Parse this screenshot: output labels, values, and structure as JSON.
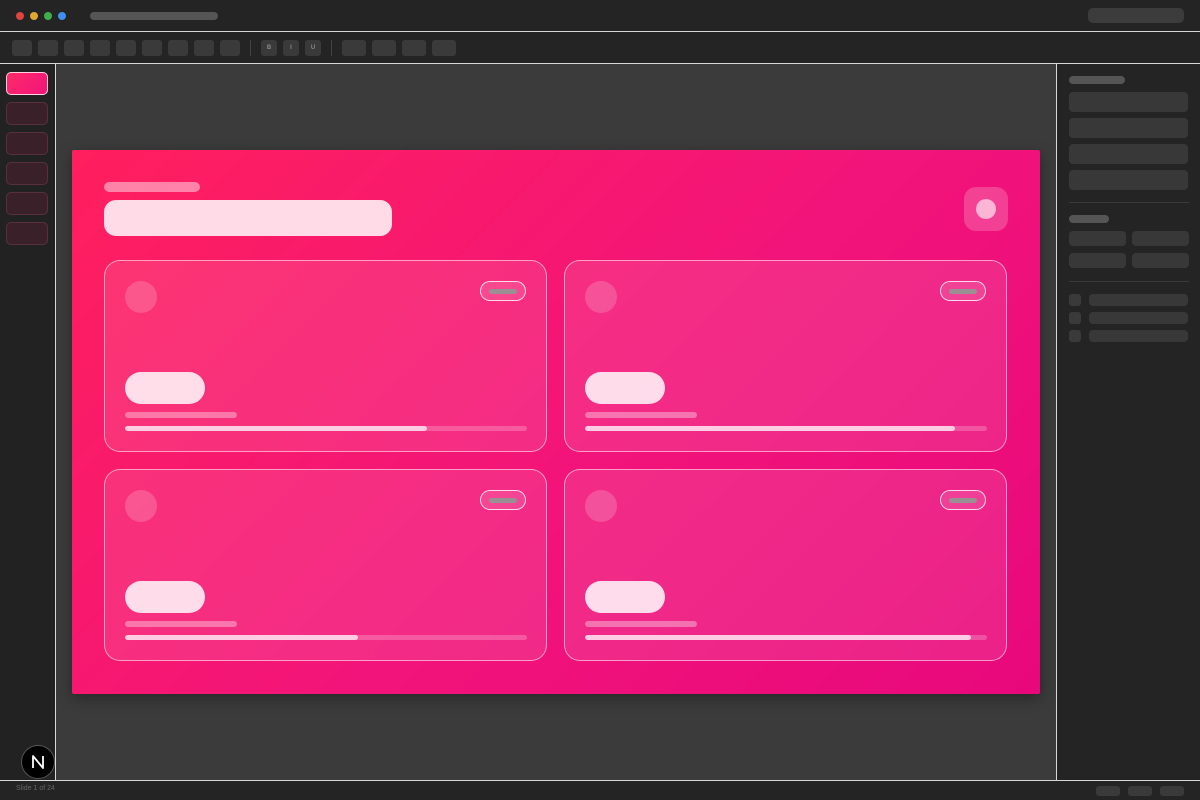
{
  "window": {
    "controls": [
      "close",
      "minimize",
      "zoom",
      "extra"
    ]
  },
  "toolbar": {
    "format_buttons": [
      {
        "label": "B",
        "name": "bold"
      },
      {
        "label": "I",
        "name": "italic"
      },
      {
        "label": "U",
        "name": "underline"
      }
    ]
  },
  "thumbnails": {
    "count": 6,
    "active_index": 0
  },
  "slide": {
    "cards": [
      {
        "progress": 0.75
      },
      {
        "progress": 0.92
      },
      {
        "progress": 0.58
      },
      {
        "progress": 0.96
      }
    ],
    "accent_colors": [
      "#ff1f5e",
      "#f2147a",
      "#e8087c"
    ]
  },
  "status": {
    "text": "Slide 1 of 24"
  },
  "logo": {
    "letter": "N",
    "icon": "n-logo-icon"
  }
}
